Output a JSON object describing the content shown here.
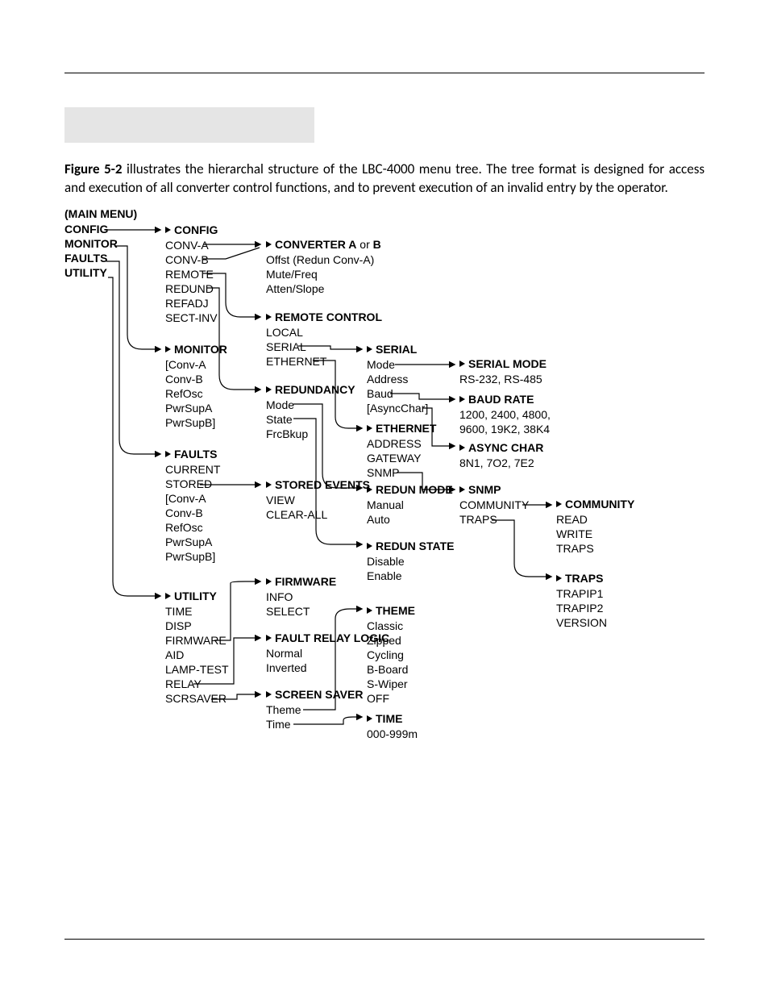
{
  "para": {
    "figref": "Figure 5-2",
    "rest": " illustrates the hierarchal structure of the LBC-4000 menu tree. The tree format is designed for access and execution of all converter control functions, and to prevent execution of an invalid entry by the operator."
  },
  "c0": {
    "main": "(MAIN MENU)",
    "items": [
      "CONFIG",
      "MONITOR",
      "FAULTS",
      "UTILITY"
    ]
  },
  "c1": {
    "config_hd": "CONFIG",
    "config_items": [
      "CONV-A",
      "CONV-B",
      "REMOTE",
      "REDUND",
      "REFADJ",
      "SECT-INV"
    ],
    "monitor_hd": "MONITOR",
    "monitor_items": [
      "[Conv-A",
      "Conv-B",
      "RefOsc",
      "PwrSupA",
      "PwrSupB]"
    ],
    "faults_hd": "FAULTS",
    "faults_items": [
      "CURRENT",
      "STORED",
      "[Conv-A",
      "Conv-B",
      "RefOsc",
      "PwrSupA",
      "PwrSupB]"
    ],
    "utility_hd": "UTILITY",
    "utility_items": [
      "TIME",
      "DISP",
      "FIRMWARE",
      "AID",
      "LAMP-TEST",
      "RELAY",
      "SCRSAVER"
    ]
  },
  "c2": {
    "conv_hd": "CONVERTER A or B",
    "conv_hd_pre": "CONVERTER A",
    "conv_hd_mid": " or ",
    "conv_hd_post": "B",
    "conv_items": [
      "Offst (Redun Conv-A)",
      "Mute/Freq",
      "Atten/Slope"
    ],
    "remote_hd": "REMOTE CONTROL",
    "remote_items": [
      "LOCAL",
      "SERIAL",
      "ETHERNET"
    ],
    "redund_hd": "REDUNDANCY",
    "redund_items": [
      "Mode",
      "State",
      "FrcBkup"
    ],
    "stored_hd": "STORED EVENTS",
    "stored_items": [
      "VIEW",
      "CLEAR-ALL"
    ],
    "firmware_hd": "FIRMWARE",
    "firmware_items": [
      "INFO",
      "SELECT"
    ],
    "fault_relay_hd": "FAULT RELAY LOGIC",
    "fault_relay_items": [
      "Normal",
      "Inverted"
    ],
    "scrsaver_hd": "SCREEN SAVER",
    "scrsaver_items": [
      "Theme",
      "Time"
    ]
  },
  "c3": {
    "serial_hd": "SERIAL",
    "serial_items": [
      "Mode",
      "Address",
      "Baud",
      "[AsyncChar]"
    ],
    "eth_hd": "ETHERNET",
    "eth_items": [
      "ADDRESS",
      "GATEWAY",
      "SNMP"
    ],
    "redmode_hd": "REDUN MODE",
    "redmode_items": [
      "Manual",
      "Auto"
    ],
    "redstate_hd": "REDUN STATE",
    "redstate_items": [
      "Disable",
      "Enable"
    ],
    "theme_hd": "THEME",
    "theme_items": [
      "Classic",
      "Zipped",
      "Cycling",
      "B-Board",
      "S-Wiper",
      "OFF"
    ],
    "time_hd": "TIME",
    "time_items": [
      "000-999m"
    ]
  },
  "c4": {
    "smode_hd": "SERIAL MODE",
    "smode_items": [
      "RS-232, RS-485"
    ],
    "baud_hd": "BAUD RATE",
    "baud_items": [
      "1200, 2400, 4800,",
      "9600, 19K2, 38K4"
    ],
    "async_hd": "ASYNC CHAR",
    "async_items": [
      "8N1, 7O2, 7E2"
    ],
    "snmp_hd": "SNMP",
    "snmp_items": [
      "COMMUNITY",
      "TRAPS"
    ]
  },
  "c5": {
    "comm_hd": "COMMUNITY",
    "comm_items": [
      "READ",
      "WRITE",
      "TRAPS"
    ],
    "traps_hd": "TRAPS",
    "traps_items": [
      "TRAPIP1",
      "TRAPIP2",
      "VERSION"
    ]
  }
}
